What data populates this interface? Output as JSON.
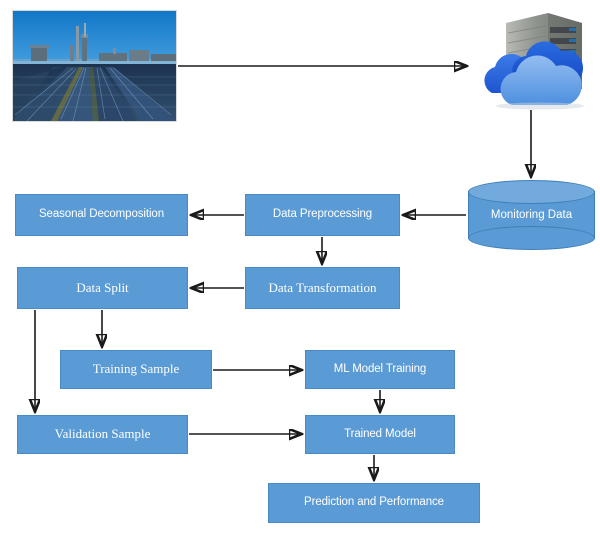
{
  "diagram": {
    "title": "Solar plant monitoring data ML pipeline flowchart",
    "colors": {
      "box_fill": "#5B9BD5",
      "box_border": "#4A8AC4",
      "box_text": "#FFFFFF",
      "arrow": "#1A1A1A",
      "cylinder_top": "#72AADD",
      "background": "#FFFFFF"
    },
    "nodes": [
      {
        "id": "solar-plant-photo",
        "type": "image",
        "label": "Solar power plant photograph",
        "alt": "Rows of solar panels with industrial towers under a blue sky"
      },
      {
        "id": "cloud-server",
        "type": "image",
        "label": "Cloud server icon",
        "alt": "Server rack behind three blue clouds"
      },
      {
        "id": "monitoring-data",
        "type": "cylinder",
        "label": "Monitoring Data",
        "font": "sans"
      },
      {
        "id": "data-preprocessing",
        "type": "box",
        "label": "Data Preprocessing",
        "font": "sans"
      },
      {
        "id": "seasonal-decomposition",
        "type": "box",
        "label": "Seasonal Decomposition",
        "font": "sans"
      },
      {
        "id": "data-transformation",
        "type": "box",
        "label": "Data Transformation",
        "font": "serif"
      },
      {
        "id": "data-split",
        "type": "box",
        "label": "Data Split",
        "font": "serif"
      },
      {
        "id": "training-sample",
        "type": "box",
        "label": "Training Sample",
        "font": "serif"
      },
      {
        "id": "validation-sample",
        "type": "box",
        "label": "Validation Sample",
        "font": "serif"
      },
      {
        "id": "ml-model-training",
        "type": "box",
        "label": "ML Model Training",
        "font": "sans"
      },
      {
        "id": "trained-model",
        "type": "box",
        "label": "Trained Model",
        "font": "sans"
      },
      {
        "id": "prediction-and-performance",
        "type": "box",
        "label": "Prediction and Performance",
        "font": "sans"
      }
    ],
    "edges": [
      {
        "from": "solar-plant-photo",
        "to": "cloud-server",
        "direction": "right"
      },
      {
        "from": "cloud-server",
        "to": "monitoring-data",
        "direction": "down"
      },
      {
        "from": "monitoring-data",
        "to": "data-preprocessing",
        "direction": "left"
      },
      {
        "from": "data-preprocessing",
        "to": "seasonal-decomposition",
        "direction": "left"
      },
      {
        "from": "data-preprocessing",
        "to": "data-transformation",
        "direction": "down"
      },
      {
        "from": "data-transformation",
        "to": "data-split",
        "direction": "left"
      },
      {
        "from": "data-split",
        "to": "training-sample",
        "direction": "down"
      },
      {
        "from": "data-split",
        "to": "validation-sample",
        "direction": "down"
      },
      {
        "from": "training-sample",
        "to": "ml-model-training",
        "direction": "right"
      },
      {
        "from": "ml-model-training",
        "to": "trained-model",
        "direction": "down"
      },
      {
        "from": "validation-sample",
        "to": "trained-model",
        "direction": "right"
      },
      {
        "from": "trained-model",
        "to": "prediction-and-performance",
        "direction": "down"
      }
    ]
  }
}
